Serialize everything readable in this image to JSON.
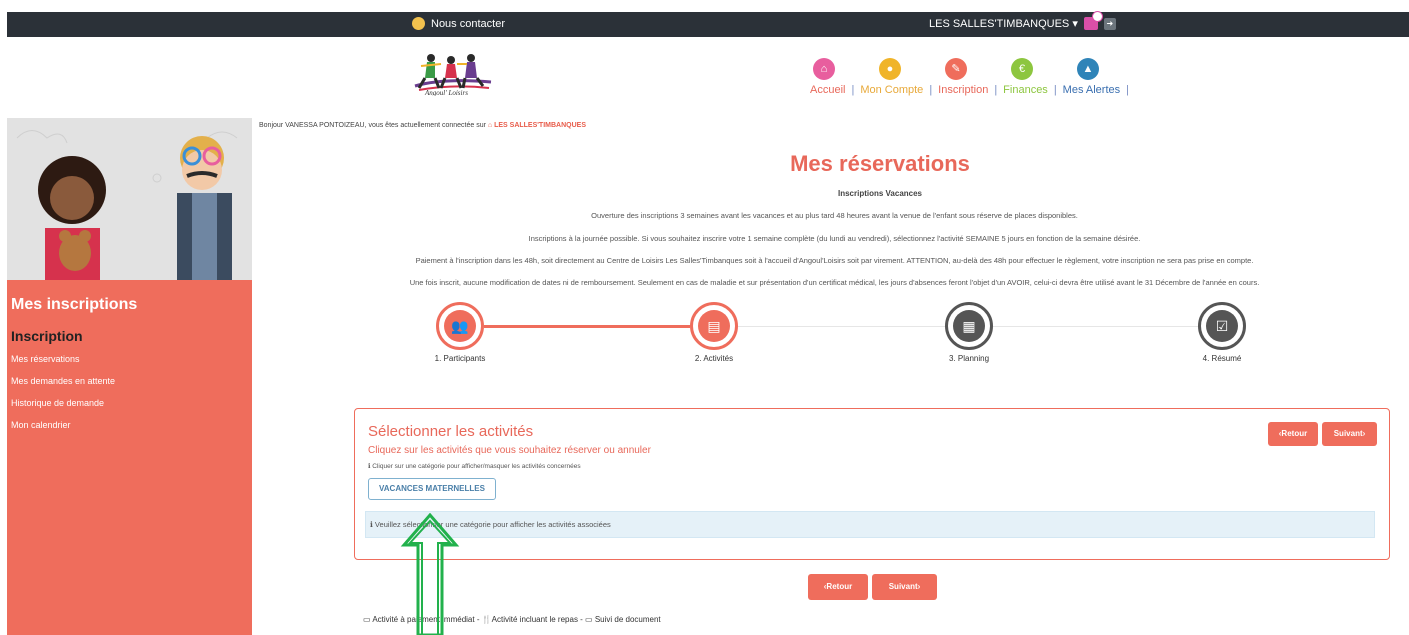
{
  "topbar": {
    "contact_label": "Nous contacter",
    "site_selector": "LES SALLES'TIMBANQUES ▾"
  },
  "nav": {
    "items": [
      {
        "label": "Accueil",
        "color": "#e8685a",
        "icon_color": "#e85e9e",
        "icon": "home-icon",
        "glyph": "⌂"
      },
      {
        "label": "Mon Compte",
        "color": "#e8a93a",
        "icon_color": "#f0b429",
        "icon": "user-icon",
        "glyph": "●"
      },
      {
        "label": "Inscription",
        "color": "#e8685a",
        "icon_color": "#ef6d5c",
        "icon": "pencil-icon",
        "glyph": "✎"
      },
      {
        "label": "Finances",
        "color": "#8dc63f",
        "icon_color": "#8dc63f",
        "icon": "euro-icon",
        "glyph": "€"
      },
      {
        "label": "Mes Alertes",
        "color": "#3a6fb0",
        "icon_color": "#2f84b8",
        "icon": "alert-icon",
        "glyph": "▲"
      }
    ]
  },
  "sidebar": {
    "title": "Mes inscriptions",
    "subtitle": "Inscription",
    "links": [
      "Mes réservations",
      "Mes demandes en attente",
      "Historique de demande",
      "Mon calendrier"
    ]
  },
  "greeting": {
    "text": "Bonjour VANESSA PONTOIZEAU, vous êtes actuellement connectée sur",
    "site": "⌂ LES SALLES'TIMBANQUES"
  },
  "page": {
    "title": "Mes réservations",
    "subtitle": "Inscriptions Vacances",
    "paragraphs": [
      "Ouverture des inscriptions 3 semaines avant les vacances et au plus tard 48 heures avant la venue de l'enfant sous réserve de places disponibles.",
      "Inscriptions à la journée possible. Si vous souhaitez inscrire votre 1 semaine complète (du lundi au vendredi), sélectionnez l'activité SEMAINE 5 jours en fonction de la semaine désirée.",
      "Paiement à l'inscription dans les 48h, soit directement au Centre de Loisirs Les Salles'Timbanques soit à l'accueil d'Angoul'Loisirs soit par virement.  ATTENTION, au-delà des 48h pour effectuer le règlement, votre inscription ne sera pas prise en compte.",
      "Une fois inscrit, aucune modification de dates ni de remboursement. Seulement en cas de maladie et sur présentation d'un certificat médical, les jours d'absences feront l'objet d'un AVOIR, celui-ci devra être utilisé avant le 31 Décembre de l'année en cours."
    ]
  },
  "steps": [
    {
      "label": "1. Participants",
      "icon": "users-icon",
      "glyph": "👥",
      "active": true
    },
    {
      "label": "2. Activités",
      "icon": "book-icon",
      "glyph": "▤",
      "active": true
    },
    {
      "label": "3. Planning",
      "icon": "calendar-icon",
      "glyph": "▦",
      "active": false
    },
    {
      "label": "4. Résumé",
      "icon": "checkbox-icon",
      "glyph": "☑",
      "active": false
    }
  ],
  "panel": {
    "title": "Sélectionner les activités",
    "subtitle": "Cliquez sur les activités que vous souhaitez réserver ou annuler",
    "hint": "ℹ Cliquer sur une catégorie pour afficher/masquer les activités concernées",
    "category": "VACANCES MATERNELLES",
    "info": "ℹ Veuillez sélectionner une catégorie pour afficher les activités associées",
    "back_label": "‹Retour",
    "next_label": "Suivant›"
  },
  "footer": {
    "back_label": "‹Retour",
    "next_label": "Suivant›",
    "legend": "▭ Activité à paiement immédiat - 🍴Activité incluant le repas - ▭ Suivi de document"
  },
  "colors": {
    "accent": "#ef6d5c",
    "inactive": "#555555",
    "arrow": "#22b14c"
  }
}
